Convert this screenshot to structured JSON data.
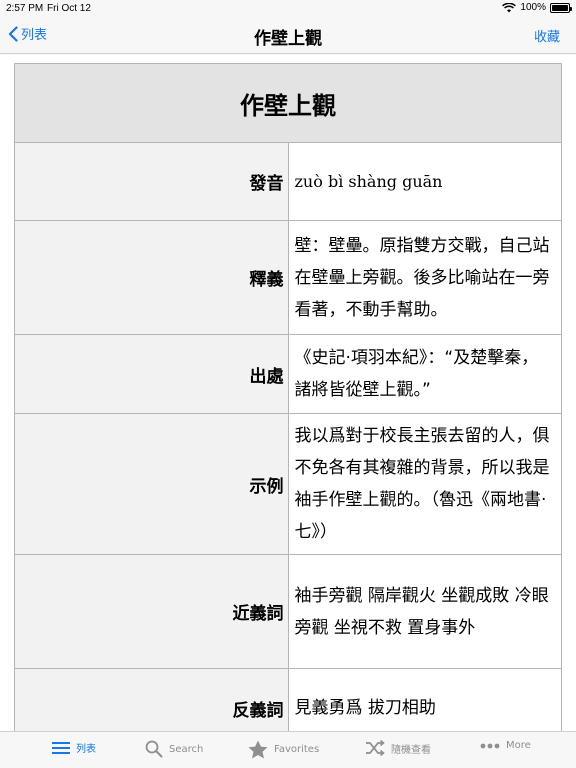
{
  "status_bar": {
    "time": "2:57 PM",
    "date": "Fri Oct 12",
    "battery": "100%"
  },
  "nav": {
    "back_label": "列表",
    "title": "作壁上觀",
    "right_label": "收藏"
  },
  "entry": {
    "title": "作壁上觀",
    "rows": [
      {
        "label": "發音",
        "value": "zuò bì shàng guān"
      },
      {
        "label": "釋義",
        "value": "壁：壁壘。原指雙方交戰，自己站在壁壘上旁觀。後多比喻站在一旁看著，不動手幫助。"
      },
      {
        "label": "出處",
        "value": "《史記·項羽本紀》：“及楚擊秦，諸將皆從壁上觀。”"
      },
      {
        "label": "示例",
        "value": "我以爲對于校長主張去留的人，俱不免各有其複雜的背景，所以我是袖手作壁上觀的。（魯迅《兩地書·七》）"
      },
      {
        "label": "近義詞",
        "value": "袖手旁觀 隔岸觀火 坐觀成敗 冷眼旁觀 坐視不救 置身事外"
      },
      {
        "label": "反義詞",
        "value": "見義勇爲 拔刀相助"
      }
    ]
  },
  "tab_bar": {
    "tabs": [
      {
        "label": "列表",
        "icon": "list-icon",
        "active": true
      },
      {
        "label": "Search",
        "icon": "search-icon",
        "active": false
      },
      {
        "label": "Favorites",
        "icon": "star-icon",
        "active": false
      },
      {
        "label": "隨機查看",
        "icon": "shuffle-icon",
        "active": false
      },
      {
        "label": "More",
        "icon": "more-icon",
        "active": false
      }
    ]
  },
  "colors": {
    "accent": "#1677e8",
    "inactive": "#8e8e93",
    "header_bg": "#e3e3e3",
    "label_bg": "#f2f2f2"
  }
}
